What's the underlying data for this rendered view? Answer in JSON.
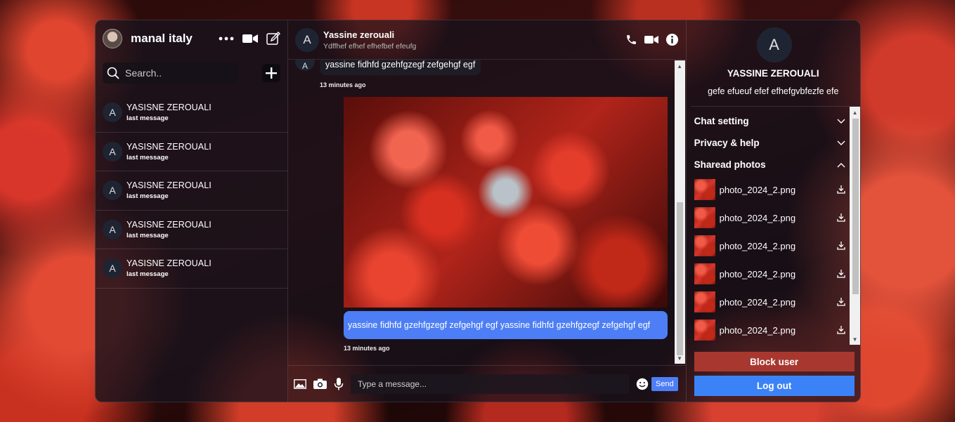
{
  "me": {
    "name": "manal italy"
  },
  "sidebar": {
    "search_placeholder": "Search..",
    "conversations": [
      {
        "avatar": "A",
        "name": "YASISNE ZEROUALI",
        "last": "last message"
      },
      {
        "avatar": "A",
        "name": "YASISNE ZEROUALI",
        "last": "last message"
      },
      {
        "avatar": "A",
        "name": "YASISNE ZEROUALI",
        "last": "last message"
      },
      {
        "avatar": "A",
        "name": "YASISNE ZEROUALI",
        "last": "last message"
      },
      {
        "avatar": "A",
        "name": "YASISNE ZEROUALI",
        "last": "last message"
      }
    ]
  },
  "chat": {
    "avatar": "A",
    "name": "Yassine zerouali",
    "status": "Ydffhef efhef efhefbef efeufg",
    "incoming": {
      "avatar": "A",
      "text": "yassine fidhfd gzehfgzegf zefgehgf egf",
      "time": "13 minutes ago"
    },
    "outgoing": {
      "text": "yassine fidhfd gzehfgzegf zefgehgf egf yassine fidhfd gzehfgzegf zefgehgf egf",
      "time": "13 minutes ago"
    },
    "composer_placeholder": "Type a message...",
    "send_label": "Send"
  },
  "details": {
    "avatar": "A",
    "name": "YASSINE ZEROUALI",
    "description": "gefe efueuf efef efhefgvbfezfe efe",
    "sections": [
      {
        "label": "Chat setting",
        "expanded": false
      },
      {
        "label": "Privacy & help",
        "expanded": false
      },
      {
        "label": "Sharead photos",
        "expanded": true
      }
    ],
    "photos": [
      {
        "name": "photo_2024_2.png"
      },
      {
        "name": "photo_2024_2.png"
      },
      {
        "name": "photo_2024_2.png"
      },
      {
        "name": "photo_2024_2.png"
      },
      {
        "name": "photo_2024_2.png"
      },
      {
        "name": "photo_2024_2.png"
      }
    ],
    "block_label": "Block user",
    "logout_label": "Log out"
  },
  "colors": {
    "accent": "#4d7ef5",
    "block": "#a8382f",
    "logout": "#3b82f6"
  }
}
